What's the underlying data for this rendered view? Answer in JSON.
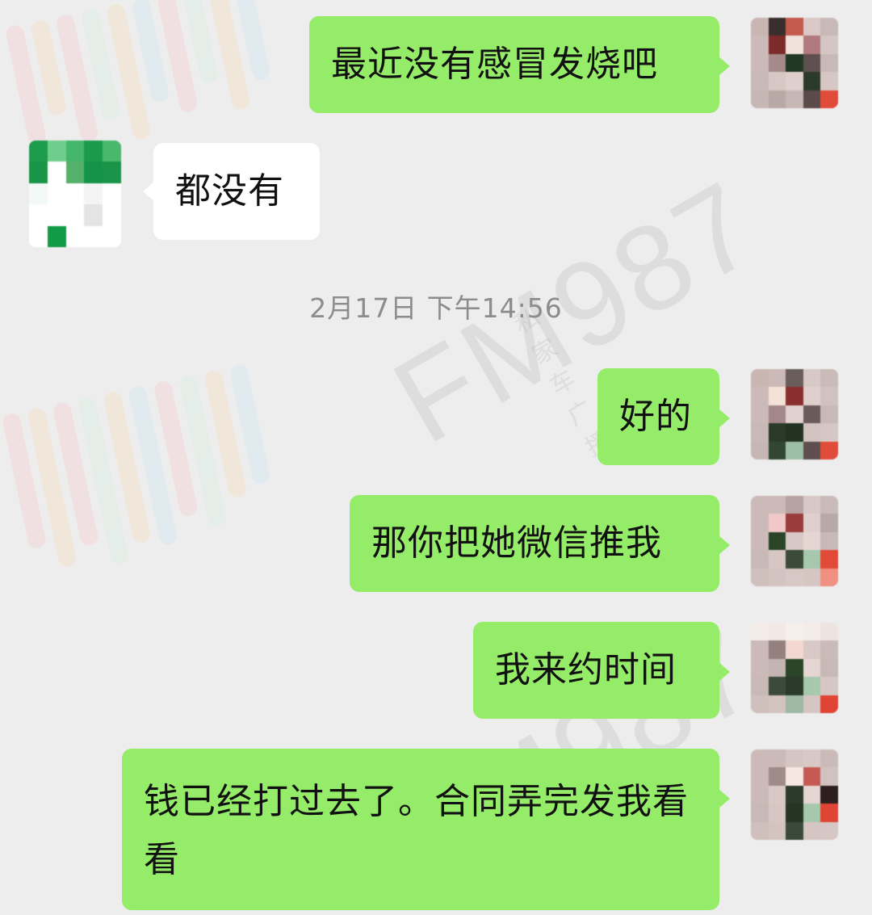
{
  "watermark": {
    "brand": "FM987",
    "sub": "私家车广播"
  },
  "timestamp": "2月17日 下午14:56",
  "messages": [
    {
      "text": "最近没有感冒发烧吧"
    },
    {
      "text": "都没有"
    },
    {
      "text": "好的"
    },
    {
      "text": "那你把她微信推我"
    },
    {
      "text": "我来约时间"
    },
    {
      "text": "钱已经打过去了。合同弄完发我看看"
    }
  ],
  "colors": {
    "sent_bubble": "#95ec69",
    "received_bubble": "#ffffff",
    "background": "#ededed",
    "timestamp_text": "#8c8c8c"
  },
  "icons": [
    "avatar-self-mosaic",
    "avatar-contact-mosaic"
  ]
}
